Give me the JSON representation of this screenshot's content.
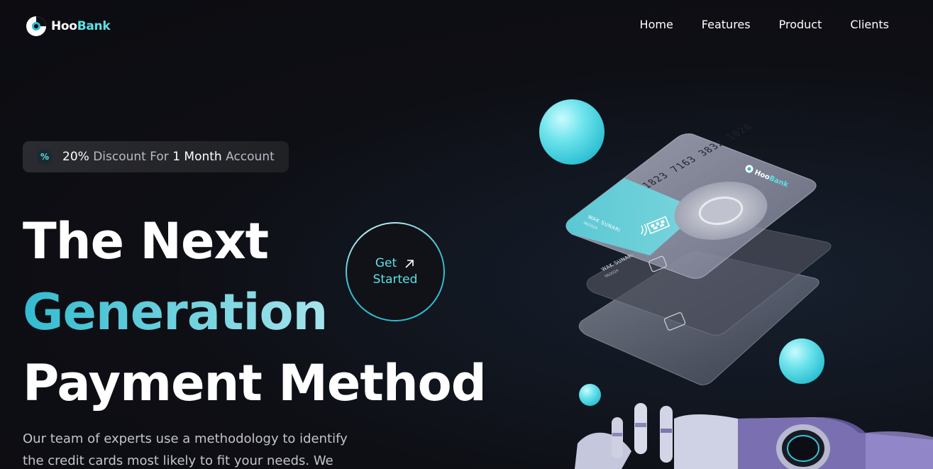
{
  "brand": {
    "name_part1": "Hoo",
    "name_part2": "Bank",
    "accent": "#5ce1e6"
  },
  "nav": {
    "items": [
      "Home",
      "Features",
      "Product",
      "Clients"
    ]
  },
  "discount": {
    "icon": "discount-icon",
    "pct": "20%",
    "mid": " Discount For ",
    "strong": "1 Month",
    "end": " Account"
  },
  "hero": {
    "line1": "The Next",
    "line2": "Generation",
    "line3": "Payment Method",
    "paragraph": "Our team of experts use a methodology to identify the credit cards most likely to fit your needs. We"
  },
  "cta": {
    "line1": "Get",
    "line2": "Started",
    "icon": "arrow-up-right-icon"
  },
  "card": {
    "number": "1823 7163 3832 1028",
    "brand_part1": "Hoo",
    "brand_part2": "Bank",
    "holder": "WAK SUNARI",
    "expiry": "06/2024",
    "holder2": "WAK SUNARI",
    "expiry2": "06/2024"
  }
}
